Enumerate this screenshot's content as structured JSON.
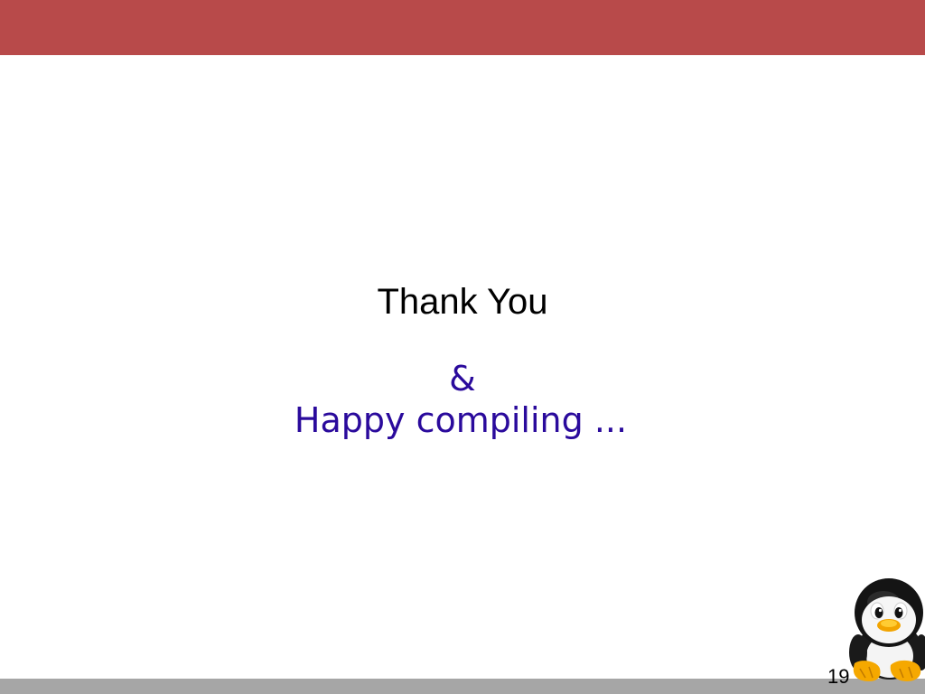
{
  "slide": {
    "title": "Thank You",
    "ampersand": "&",
    "subtitle": "Happy compiling ...",
    "page_number": "19"
  },
  "colors": {
    "header_bar": "#b84a4a",
    "footer_bar": "#a6a6a6",
    "title_text": "#000000",
    "subtitle_text": "#2a0a9c"
  },
  "icons": {
    "mascot": "penguin-icon"
  }
}
